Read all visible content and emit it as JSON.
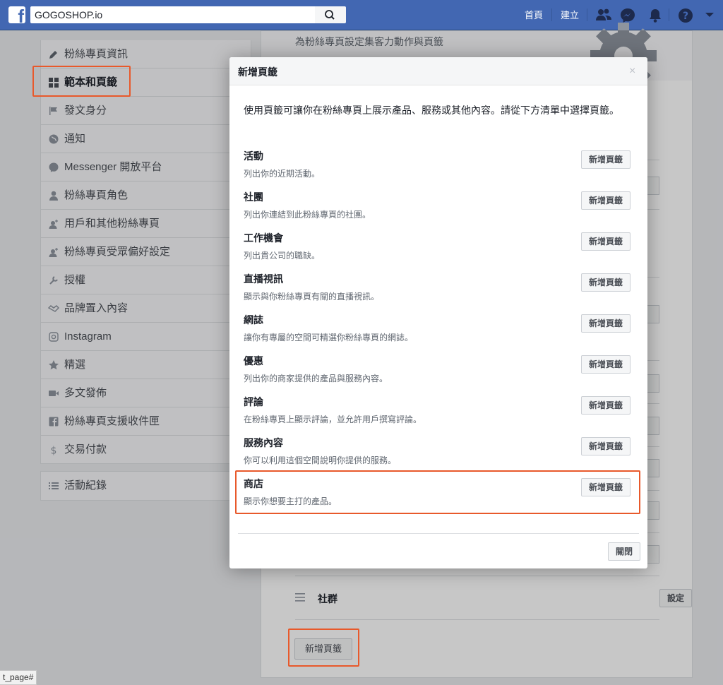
{
  "topbar": {
    "search_value": "GOGOSHOP.io",
    "nav_home": "首頁",
    "nav_create": "建立"
  },
  "sidebar": {
    "items": [
      {
        "label": "粉絲專頁資訊",
        "icon": "pencil-icon"
      },
      {
        "label": "範本和頁籤",
        "icon": "grid-icon"
      },
      {
        "label": "發文身分",
        "icon": "flag-icon"
      },
      {
        "label": "通知",
        "icon": "globe-icon"
      },
      {
        "label": "Messenger 開放平台",
        "icon": "messenger-icon"
      },
      {
        "label": "粉絲專頁角色",
        "icon": "person-icon"
      },
      {
        "label": "用戶和其他粉絲專頁",
        "icon": "person-add-icon"
      },
      {
        "label": "粉絲專頁受眾偏好設定",
        "icon": "person-add-icon"
      },
      {
        "label": "授權",
        "icon": "wrench-icon"
      },
      {
        "label": "品牌置入內容",
        "icon": "handshake-icon"
      },
      {
        "label": "Instagram",
        "icon": "instagram-icon"
      },
      {
        "label": "精選",
        "icon": "star-icon"
      },
      {
        "label": "多文發佈",
        "icon": "video-icon"
      },
      {
        "label": "粉絲專頁支援收件匣",
        "icon": "facebook-square-icon"
      },
      {
        "label": "交易付款",
        "icon": "dollar-icon"
      }
    ],
    "activity_log": "活動紀錄"
  },
  "main": {
    "subtitle": "為粉絲專頁設定集客力動作與頁籤",
    "community_label": "社群",
    "settings_label": "設定",
    "add_tab_label": "新增頁籤"
  },
  "modal": {
    "title": "新增頁籤",
    "close_glyph": "×",
    "description": "使用頁籤可讓你在粉絲專頁上展示產品、服務或其他內容。請從下方清單中選擇頁籤。",
    "add_label": "新增頁籤",
    "tabs": [
      {
        "name": "活動",
        "desc": "列出你的近期活動。"
      },
      {
        "name": "社團",
        "desc": "列出你連結到此粉絲專頁的社團。"
      },
      {
        "name": "工作機會",
        "desc": "列出貴公司的職缺。"
      },
      {
        "name": "直播視訊",
        "desc": "顯示與你粉絲專頁有關的直播視訊。"
      },
      {
        "name": "網誌",
        "desc": "讓你有專屬的空間可精選你粉絲專頁的網誌。"
      },
      {
        "name": "優惠",
        "desc": "列出你的商家提供的產品與服務內容。"
      },
      {
        "name": "評論",
        "desc": "在粉絲專頁上顯示評論，並允許用戶撰寫評論。"
      },
      {
        "name": "服務內容",
        "desc": "你可以利用這個空間說明你提供的服務。"
      },
      {
        "name": "商店",
        "desc": "顯示你想要主打的產品。"
      }
    ],
    "close_button": "關閉"
  },
  "statusbar": {
    "text": "t_page#"
  },
  "colors": {
    "fb_blue": "#4267b2",
    "highlight": "#e8592b"
  }
}
